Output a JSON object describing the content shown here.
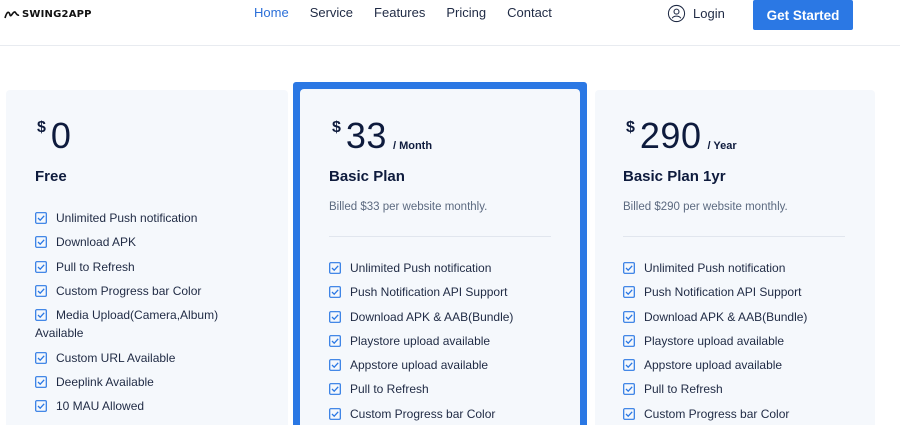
{
  "nav": {
    "logo_text": "SWING2APP",
    "links": [
      {
        "label": "Home",
        "active": true
      },
      {
        "label": "Service",
        "active": false
      },
      {
        "label": "Features",
        "active": false
      },
      {
        "label": "Pricing",
        "active": false
      },
      {
        "label": "Contact",
        "active": false
      }
    ],
    "login_label": "Login",
    "cta_label": "Get Started"
  },
  "colors": {
    "accent": "#2b78e4",
    "active_link": "#2b6fd8",
    "card_bg": "#f5f8fc",
    "heading": "#0e1b3d"
  },
  "plans": [
    {
      "currency": "$",
      "amount": "0",
      "period": "",
      "name": "Free",
      "billed": "",
      "features": [
        "Unlimited Push notification",
        "Download APK",
        "Pull to Refresh",
        "Custom Progress bar Color",
        "Media Upload(Camera,Album)",
        "Available",
        "Custom URL Available",
        "Deeplink Available",
        "10 MAU Allowed"
      ]
    },
    {
      "currency": "$",
      "amount": "33",
      "period": "/ Month",
      "name": "Basic Plan",
      "billed": "Billed $33 per website monthly.",
      "featured": true,
      "features": [
        "Unlimited Push notification",
        "Push Notification API Support",
        "Download APK & AAB(Bundle)",
        "Playstore upload available",
        "Appstore upload available",
        "Pull to Refresh",
        "Custom Progress bar Color"
      ]
    },
    {
      "currency": "$",
      "amount": "290",
      "period": "/ Year",
      "name": "Basic Plan 1yr",
      "billed": "Billed $290 per website monthly.",
      "features": [
        "Unlimited Push notification",
        "Push Notification API Support",
        "Download APK & AAB(Bundle)",
        "Playstore upload available",
        "Appstore upload available",
        "Pull to Refresh",
        "Custom Progress bar Color"
      ]
    }
  ]
}
